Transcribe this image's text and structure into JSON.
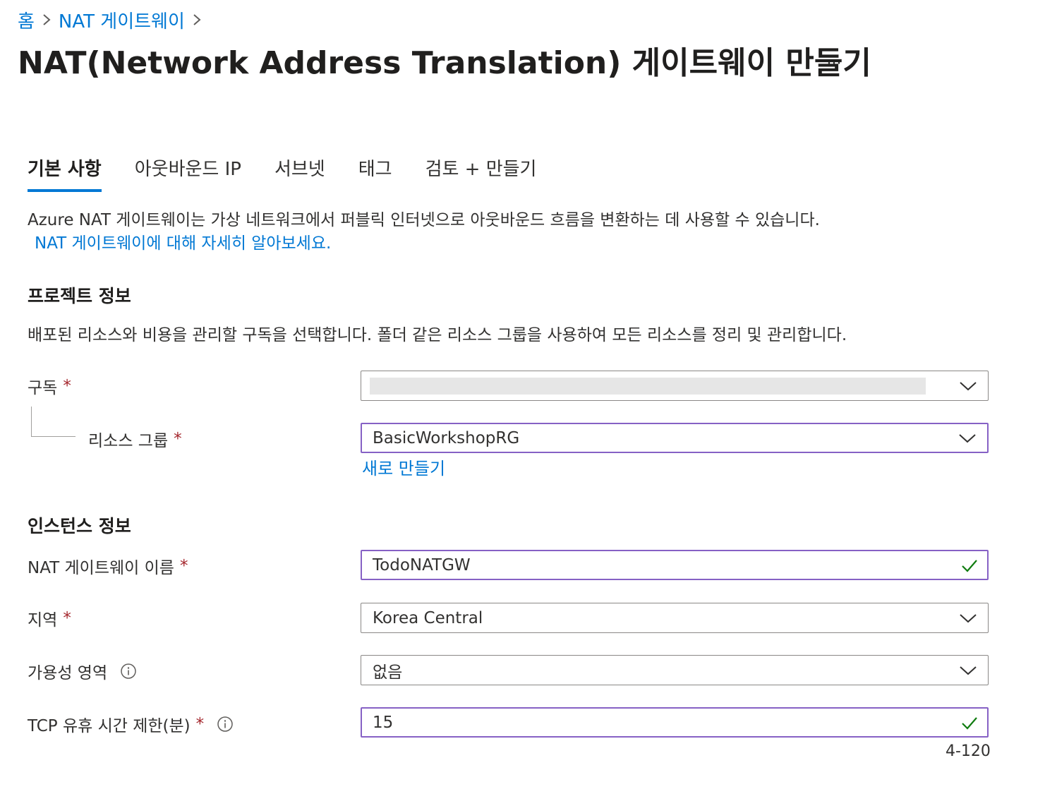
{
  "breadcrumb": {
    "home": "홈",
    "parent": "NAT 게이트웨이"
  },
  "page": {
    "title": "NAT(Network Address Translation) 게이트웨이 만들기",
    "more_label": "···"
  },
  "tabs": [
    {
      "label": "기본 사항",
      "active": true
    },
    {
      "label": "아웃바운드 IP",
      "active": false
    },
    {
      "label": "서브넷",
      "active": false
    },
    {
      "label": "태그",
      "active": false
    },
    {
      "label": "검토 + 만들기",
      "active": false
    }
  ],
  "intro": {
    "text": "Azure NAT 게이트웨이는 가상 네트워크에서 퍼블릭 인터넷으로 아웃바운드 흐름을 변환하는 데 사용할 수 있습니다.",
    "learn_more": "NAT 게이트웨이에 대해 자세히 알아보세요."
  },
  "project": {
    "heading": "프로젝트 정보",
    "description": "배포된 리소스와 비용을 관리할 구독을 선택합니다. 폴더 같은 리소스 그룹을 사용하여 모든 리소스를 정리 및 관리합니다.",
    "subscription": {
      "label": "구독",
      "required": "*",
      "value": ""
    },
    "resource_group": {
      "label": "리소스 그룹",
      "required": "*",
      "value": "BasicWorkshopRG",
      "create_new": "새로 만들기"
    }
  },
  "instance": {
    "heading": "인스턴스 정보",
    "name": {
      "label": "NAT 게이트웨이 이름",
      "required": "*",
      "value": "TodoNATGW",
      "valid": true
    },
    "region": {
      "label": "지역",
      "required": "*",
      "value": "Korea Central"
    },
    "availability_zone": {
      "label": "가용성 영역",
      "value": "없음"
    },
    "tcp_idle_timeout": {
      "label": "TCP 유휴 시간 제한(분)",
      "required": "*",
      "value": "15",
      "range_hint": "4-120",
      "valid": true
    }
  },
  "colors": {
    "accent": "#0078d4",
    "focus_border": "#8661c5",
    "required": "#a4262c",
    "valid_check": "#107c10"
  }
}
